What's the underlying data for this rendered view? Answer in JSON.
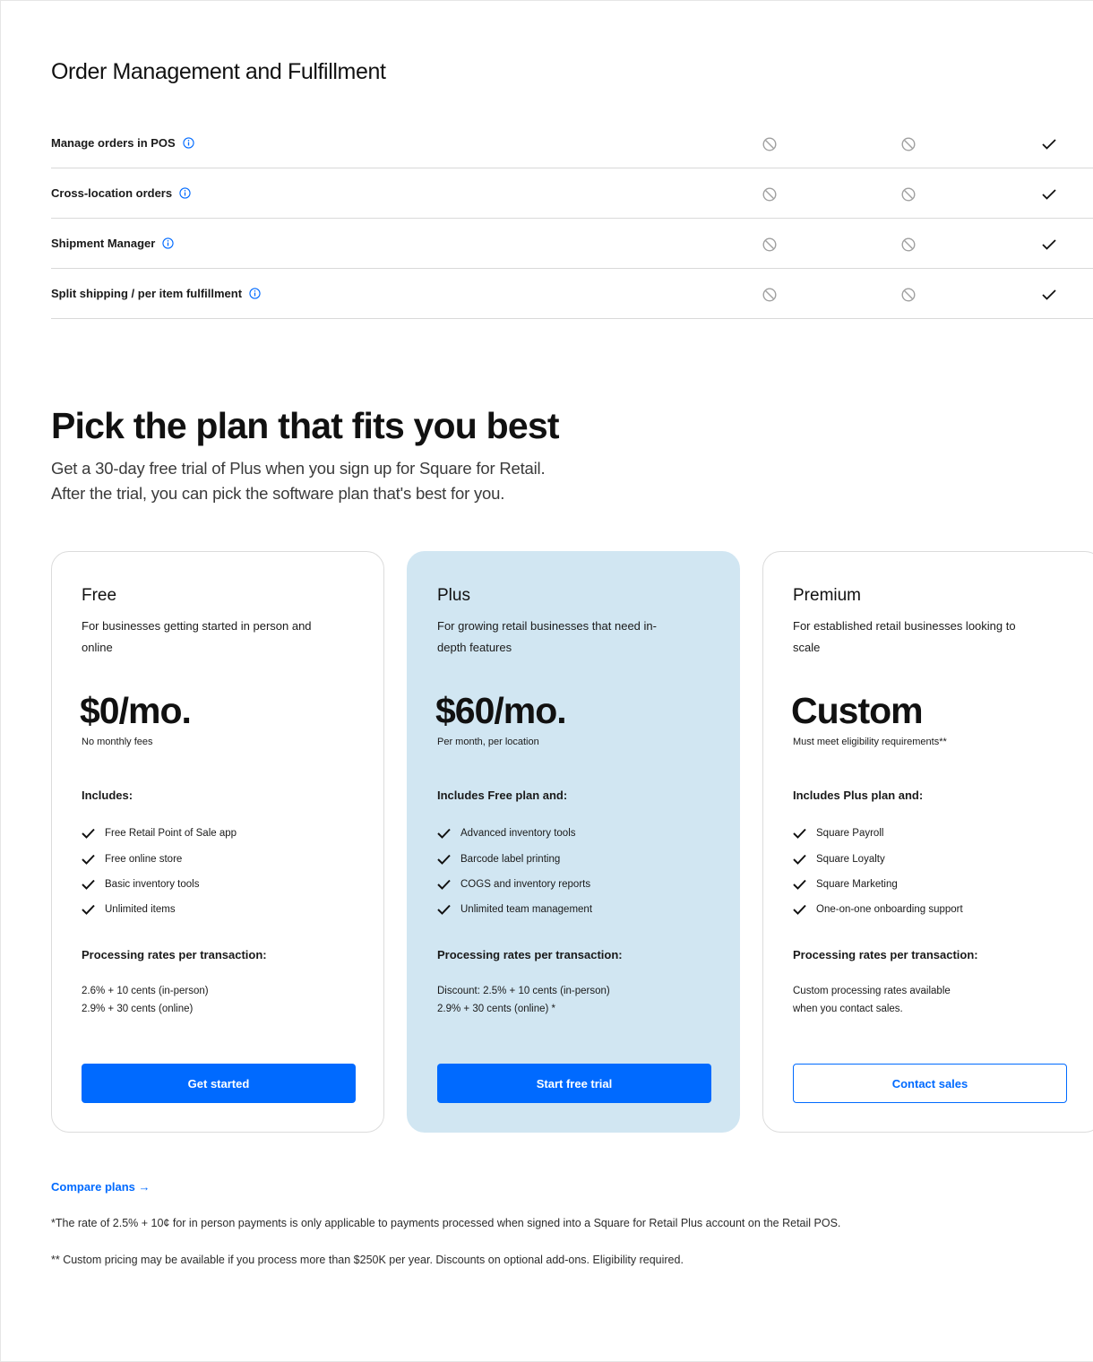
{
  "order_section": {
    "title": "Order Management and Fulfillment",
    "rows": [
      {
        "label": "Manage orders in POS",
        "free": "not-included",
        "plus": "not-included",
        "premium": "included"
      },
      {
        "label": "Cross-location orders",
        "free": "not-included",
        "plus": "not-included",
        "premium": "included"
      },
      {
        "label": "Shipment Manager",
        "free": "not-included",
        "plus": "not-included",
        "premium": "included"
      },
      {
        "label": "Split shipping / per item fulfillment",
        "free": "not-included",
        "plus": "not-included",
        "premium": "included"
      }
    ]
  },
  "hero": {
    "title": "Pick the plan that fits you best",
    "subtitle_line1": "Get a 30-day free trial of Plus when you sign up for Square for Retail.",
    "subtitle_line2": "After the trial, you can pick the software plan that's best for you."
  },
  "plans": [
    {
      "name": "Free",
      "description": "For businesses getting started in person and online",
      "price": "$0/mo.",
      "price_note": "No monthly fees",
      "includes_title": "Includes:",
      "features": [
        "Free Retail Point of Sale app",
        "Free online store",
        "Basic inventory tools",
        "Unlimited items"
      ],
      "rates_title": "Processing rates per transaction:",
      "rates_line1": "2.6% + 10 cents (in-person)",
      "rates_line2": "2.9% + 30 cents (online)",
      "button": "Get started"
    },
    {
      "name": "Plus",
      "description": "For growing retail businesses that need in-depth features",
      "price": "$60/mo.",
      "price_note": "Per month, per location",
      "includes_title": "Includes Free plan and:",
      "features": [
        "Advanced inventory tools",
        "Barcode label printing",
        "COGS and inventory reports",
        "Unlimited team management"
      ],
      "rates_title": "Processing rates per transaction:",
      "rates_line1": "Discount: 2.5% + 10 cents (in-person)",
      "rates_line2": "2.9% + 30 cents (online) *",
      "button": "Start free trial"
    },
    {
      "name": "Premium",
      "description": "For established retail businesses looking to scale",
      "price": "Custom",
      "price_note": "Must meet eligibility requirements**",
      "includes_title": "Includes Plus plan and:",
      "features": [
        "Square Payroll",
        "Square Loyalty",
        "Square Marketing",
        "One-on-one onboarding support"
      ],
      "rates_title": "Processing rates per transaction:",
      "rates_line1": "Custom processing rates available",
      "rates_line2": "when you contact sales.",
      "button": "Contact sales"
    }
  ],
  "compare_link": "Compare plans →",
  "footnotes": [
    "*The rate of 2.5% + 10¢ for in person payments is only applicable to payments processed when signed into a Square for Retail Plus account on the Retail POS.",
    "** Custom pricing may be available if you process more than $250K per year. Discounts on optional add-ons. Eligibility required."
  ],
  "colors": {
    "accent": "#006aff",
    "plus_card_bg": "#d1e6f2",
    "divider": "#d9d9d9",
    "not_included_icon": "#a0a0a0"
  }
}
